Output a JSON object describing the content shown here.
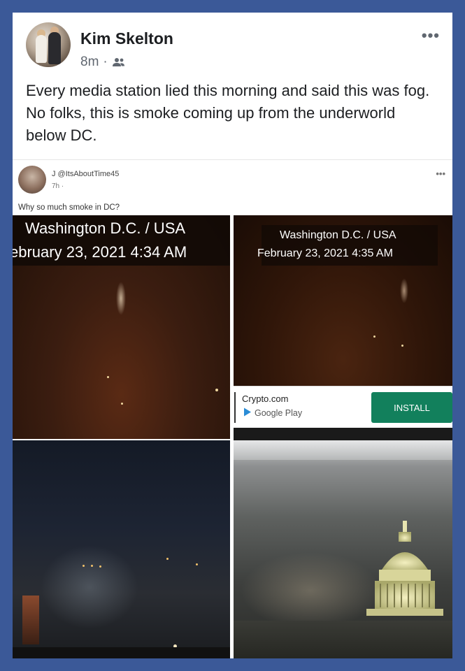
{
  "post": {
    "author": "Kim Skelton",
    "time": "8m",
    "separator": "·",
    "audience_icon": "friends-icon",
    "more": "•••",
    "text": "Every media station lied this morning and said this was fog. No folks, this is smoke coming up from the underworld below DC."
  },
  "embedded_post": {
    "handle": "J @ItsAboutTime45",
    "time": "7h ·",
    "more": "•••",
    "text": "Why so much smoke in DC?"
  },
  "photos": {
    "top_left": {
      "line1": "Washington D.C. / USA",
      "line2": "ebruary 23, 2021 4:34 AM"
    },
    "top_right": {
      "line1": "Washington D.C. / USA",
      "line2": "February 23, 2021 4:35 AM"
    }
  },
  "ad": {
    "brand": "Crypto.com",
    "store": "Google Play",
    "button": "INSTALL"
  },
  "colors": {
    "background": "#3b5998",
    "install_button": "#12805c"
  }
}
